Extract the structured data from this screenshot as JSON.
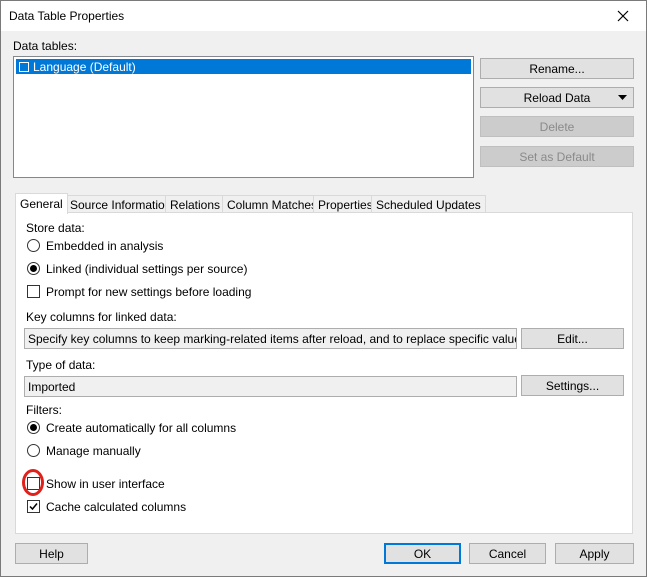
{
  "window": {
    "title": "Data Table Properties"
  },
  "data_tables": {
    "label": "Data tables:",
    "items": [
      {
        "label": "Language (Default)",
        "selected": true
      }
    ]
  },
  "side_buttons": {
    "rename": "Rename...",
    "reload": "Reload Data",
    "delete": "Delete",
    "set_default": "Set as Default"
  },
  "tabs": [
    {
      "label": "General",
      "active": true
    },
    {
      "label": "Source Information"
    },
    {
      "label": "Relations"
    },
    {
      "label": "Column Matches"
    },
    {
      "label": "Properties"
    },
    {
      "label": "Scheduled Updates"
    }
  ],
  "general": {
    "store_data_label": "Store data:",
    "embedded": "Embedded in analysis",
    "linked": "Linked (individual settings per source)",
    "prompt": "Prompt for new settings before loading",
    "key_columns_label": "Key columns for linked data:",
    "key_columns_value": "Specify key columns to keep marking-related items after reload, and to replace specific values",
    "edit_button": "Edit...",
    "type_label": "Type of data:",
    "type_value": "Imported",
    "settings_button": "Settings...",
    "filters_label": "Filters:",
    "create_auto": "Create automatically for all columns",
    "manage_manually": "Manage manually",
    "show_in_ui": "Show in user interface",
    "cache_calc": "Cache calculated columns"
  },
  "state": {
    "store": "linked",
    "prompt_checked": false,
    "filters": "create_auto",
    "show_in_ui_checked": false,
    "cache_calc_checked": true
  },
  "footer": {
    "help": "Help",
    "ok": "OK",
    "cancel": "Cancel",
    "apply": "Apply"
  },
  "colors": {
    "selection": "#0078d7",
    "annotation": "#e0201b"
  }
}
